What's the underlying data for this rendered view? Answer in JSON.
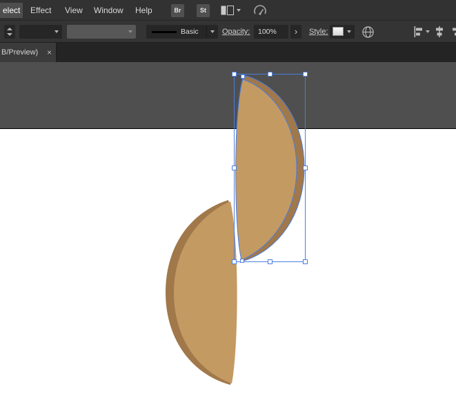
{
  "menu_bar": {
    "items": [
      {
        "label": "elect"
      },
      {
        "label": "Effect"
      },
      {
        "label": "View"
      },
      {
        "label": "Window"
      },
      {
        "label": "Help"
      }
    ],
    "bridge_button": "Br",
    "stock_button": "St"
  },
  "control_bar": {
    "brush_definition": "Basic",
    "opacity_label": "Opacity:",
    "opacity_value": "100%",
    "more_options": "›",
    "style_label": "Style:"
  },
  "tab_bar": {
    "active_tab_label": "B/Preview)",
    "close_glyph": "×"
  },
  "colors": {
    "selection_blue": "#4a7de0",
    "handle_fill": "#ffffff",
    "shape_tan": "#c49a63",
    "shape_brown": "#a1784a"
  }
}
